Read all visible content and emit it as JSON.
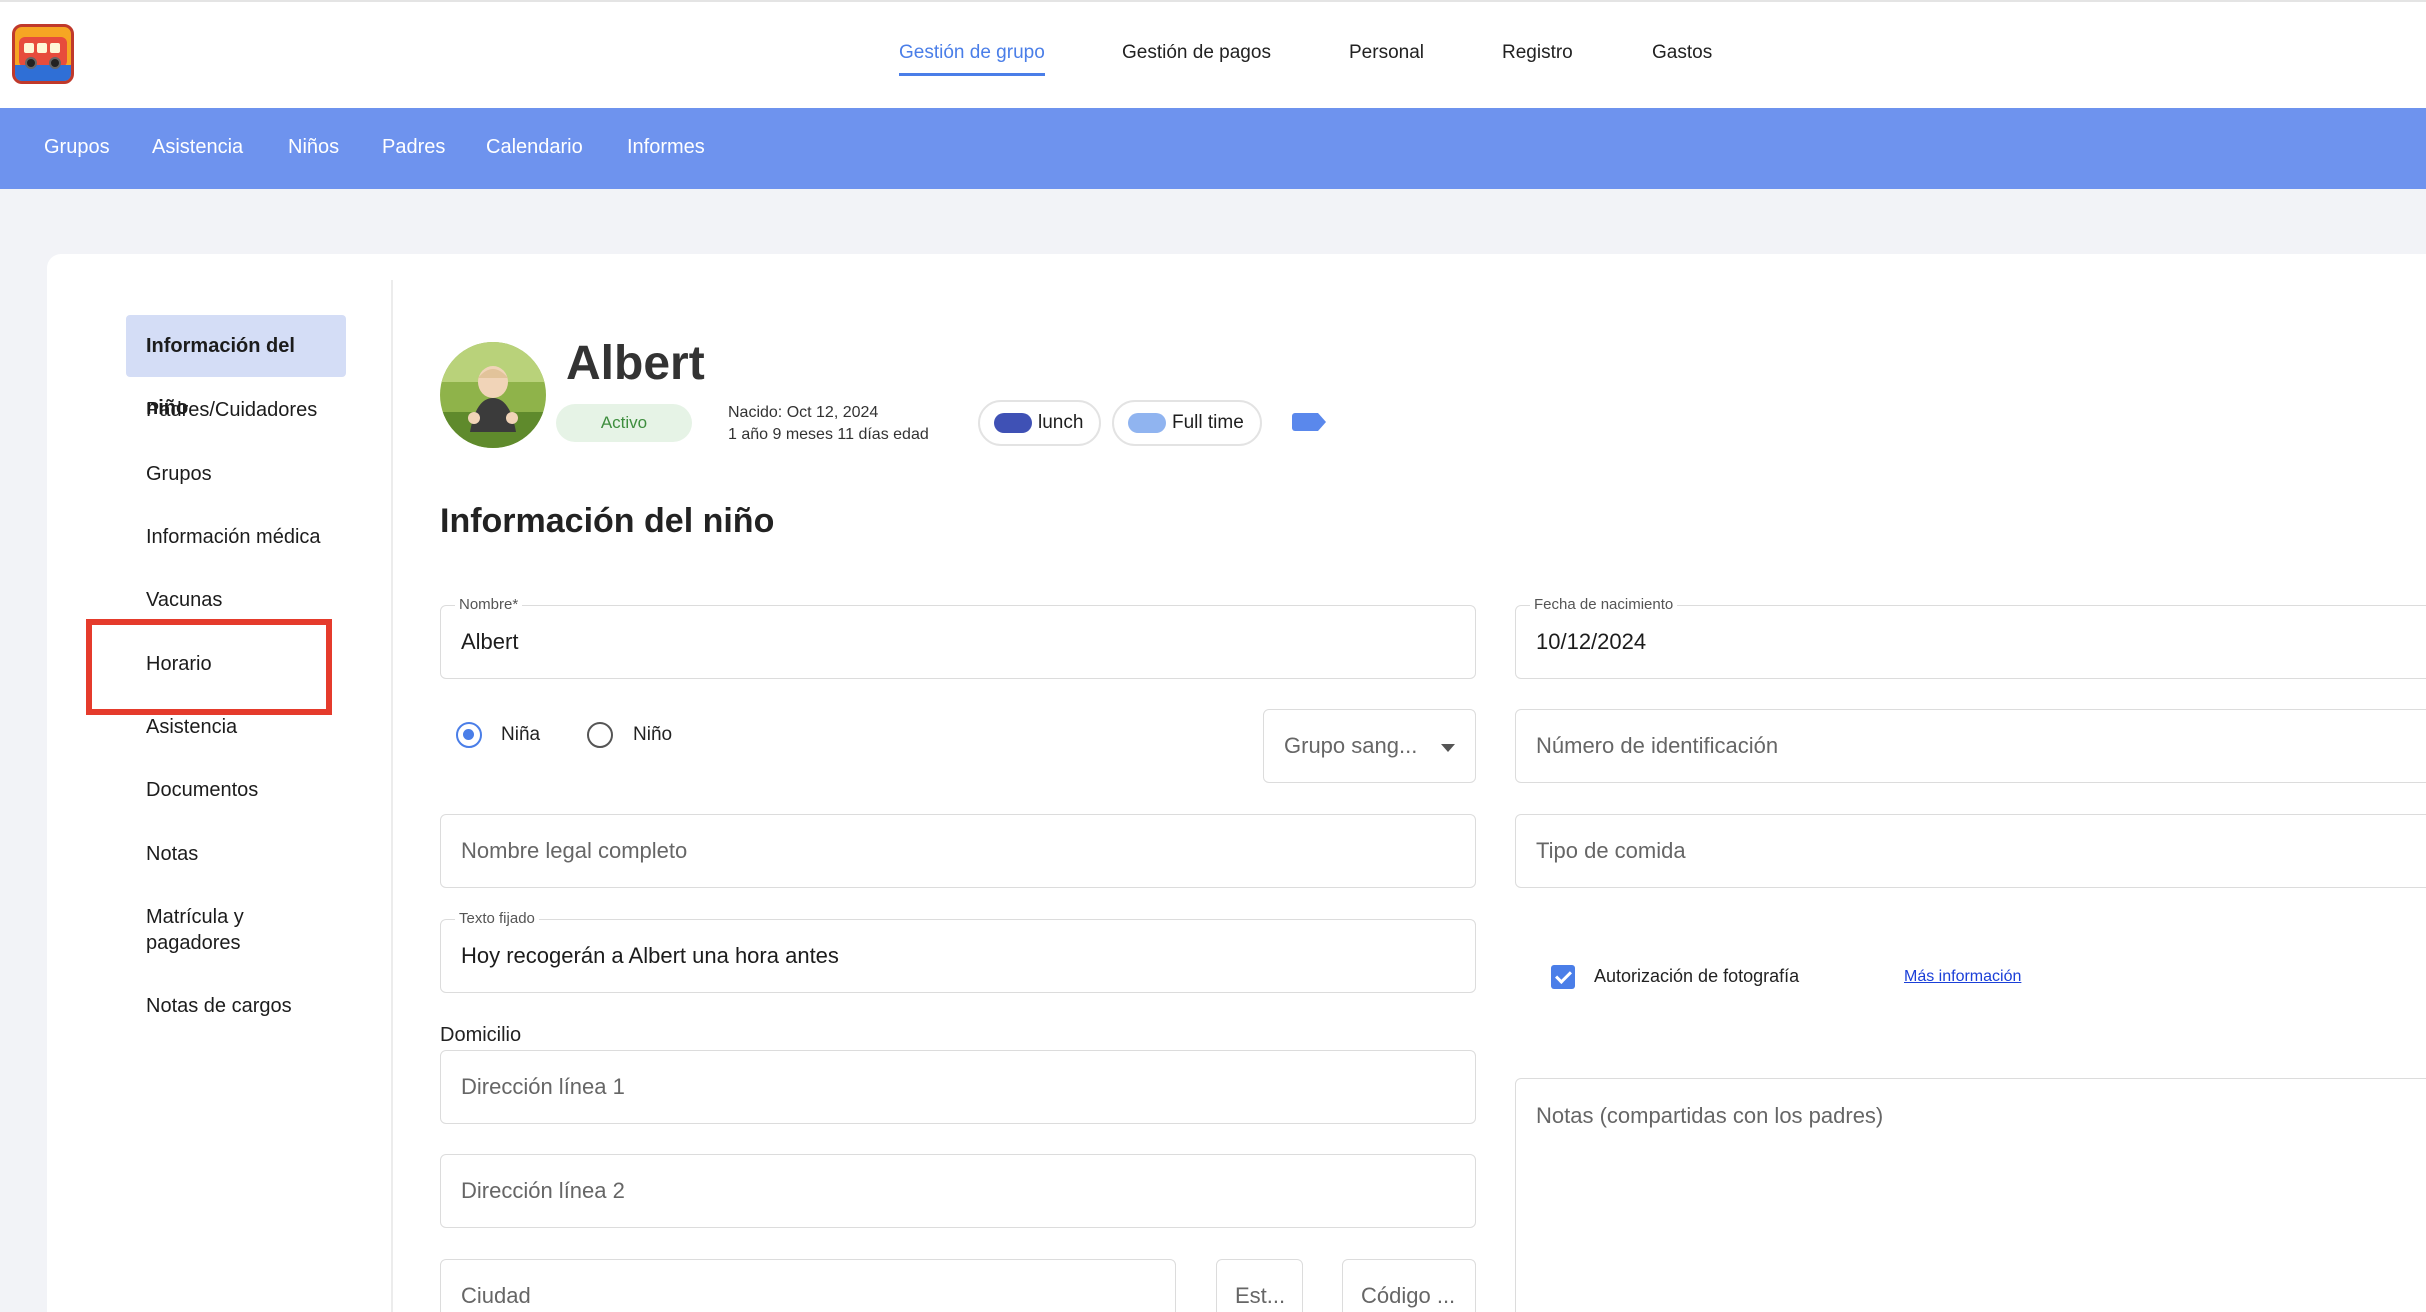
{
  "top_nav": {
    "items": [
      "Gestión de grupo",
      "Gestión de pagos",
      "Personal",
      "Registro",
      "Gastos"
    ],
    "active": "Gestión de grupo"
  },
  "sub_nav": {
    "items": [
      "Grupos",
      "Asistencia",
      "Niños",
      "Padres",
      "Calendario",
      "Informes"
    ]
  },
  "sidebar": {
    "items": [
      {
        "label": "Información del niño",
        "active": true
      },
      {
        "label": "Padres/Cuidadores"
      },
      {
        "label": "Grupos"
      },
      {
        "label": "Información médica"
      },
      {
        "label": "Vacunas"
      },
      {
        "label": "Horario",
        "highlighted": true
      },
      {
        "label": "Asistencia"
      },
      {
        "label": "Documentos"
      },
      {
        "label": "Notas"
      },
      {
        "label": "Matrícula y pagadores"
      },
      {
        "label": "Notas de cargos"
      }
    ]
  },
  "child": {
    "name": "Albert",
    "status": "Activo",
    "born": "Nacido: Oct 12, 2024",
    "age": "1 año 9 meses 11 días edad",
    "tags": [
      {
        "label": "lunch",
        "color": "#3f51b5"
      },
      {
        "label": "Full time",
        "color": "#90b4f0"
      }
    ]
  },
  "section_title": "Información del niño",
  "form": {
    "first_name": {
      "label": "Nombre*",
      "value": "Albert"
    },
    "birth_date": {
      "label": "Fecha de nacimiento",
      "value": "10/12/2024"
    },
    "gender_options": [
      "Niña",
      "Niño"
    ],
    "gender_selected": "Niña",
    "blood_group": {
      "placeholder": "Grupo sang..."
    },
    "id_number": {
      "placeholder": "Número de identificación"
    },
    "legal_name": {
      "placeholder": "Nombre legal completo"
    },
    "food_type": {
      "placeholder": "Tipo de comida"
    },
    "pinned_text": {
      "label": "Texto fijado",
      "value": "Hoy recogerán a Albert una hora antes"
    },
    "photo_auth": {
      "label": "Autorización de fotografía",
      "checked": true,
      "link": "Más información"
    },
    "address_heading": "Domicilio",
    "address_1": {
      "placeholder": "Dirección línea 1"
    },
    "address_2": {
      "placeholder": "Dirección línea 2"
    },
    "city": {
      "placeholder": "Ciudad"
    },
    "state": {
      "placeholder": "Est..."
    },
    "zip": {
      "placeholder": "Código ..."
    },
    "notes": {
      "placeholder": "Notas (compartidas con los padres)"
    }
  },
  "colors": {
    "primary": "#4a7ee8",
    "subnav_bg": "#6e93ee",
    "sidebar_active_bg": "#d4ddf6",
    "highlight_box": "#e53b2c",
    "status_green": "#3e8e3e"
  }
}
